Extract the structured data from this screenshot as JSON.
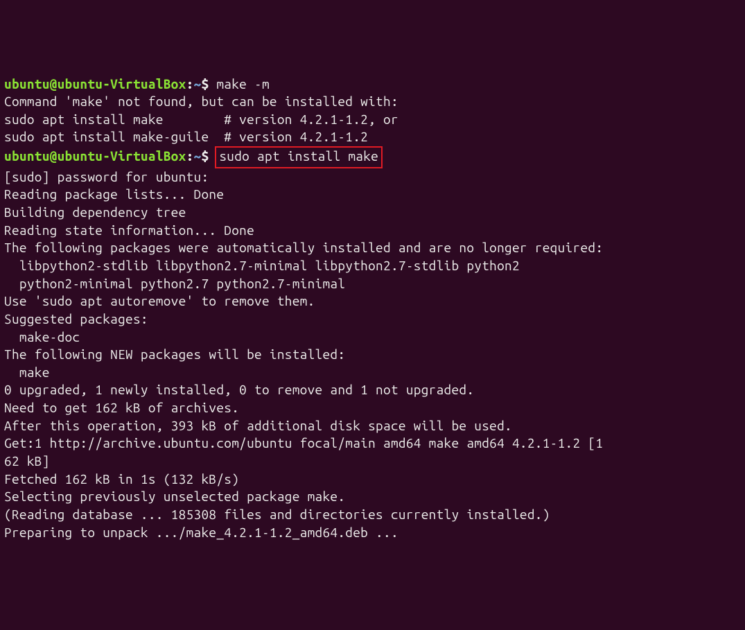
{
  "prompt1": {
    "userhost": "ubuntu@ubuntu-VirtualBox",
    "colon": ":",
    "tilde": "~",
    "dollar": "$ ",
    "command": "make -m"
  },
  "block1": {
    "l1": "",
    "l2": "Command 'make' not found, but can be installed with:",
    "l3": "",
    "l4": "sudo apt install make        # version 4.2.1-1.2, or",
    "l5": "sudo apt install make-guile  # version 4.2.1-1.2",
    "l6": ""
  },
  "prompt2": {
    "userhost": "ubuntu@ubuntu-VirtualBox",
    "colon": ":",
    "tilde": "~",
    "dollar": "$ ",
    "command": "sudo apt install make"
  },
  "block2": {
    "l1": "[sudo] password for ubuntu:",
    "l2": "Reading package lists... Done",
    "l3": "Building dependency tree",
    "l4": "Reading state information... Done",
    "l5": "The following packages were automatically installed and are no longer required:",
    "l6": "  libpython2-stdlib libpython2.7-minimal libpython2.7-stdlib python2",
    "l7": "  python2-minimal python2.7 python2.7-minimal",
    "l8": "Use 'sudo apt autoremove' to remove them.",
    "l9": "Suggested packages:",
    "l10": "  make-doc",
    "l11": "The following NEW packages will be installed:",
    "l12": "  make",
    "l13": "0 upgraded, 1 newly installed, 0 to remove and 1 not upgraded.",
    "l14": "Need to get 162 kB of archives.",
    "l15": "After this operation, 393 kB of additional disk space will be used.",
    "l16": "Get:1 http://archive.ubuntu.com/ubuntu focal/main amd64 make amd64 4.2.1-1.2 [1",
    "l17": "62 kB]",
    "l18": "Fetched 162 kB in 1s (132 kB/s)",
    "l19": "Selecting previously unselected package make.",
    "l20": "(Reading database ... 185308 files and directories currently installed.)",
    "l21": "Preparing to unpack .../make_4.2.1-1.2_amd64.deb ..."
  }
}
